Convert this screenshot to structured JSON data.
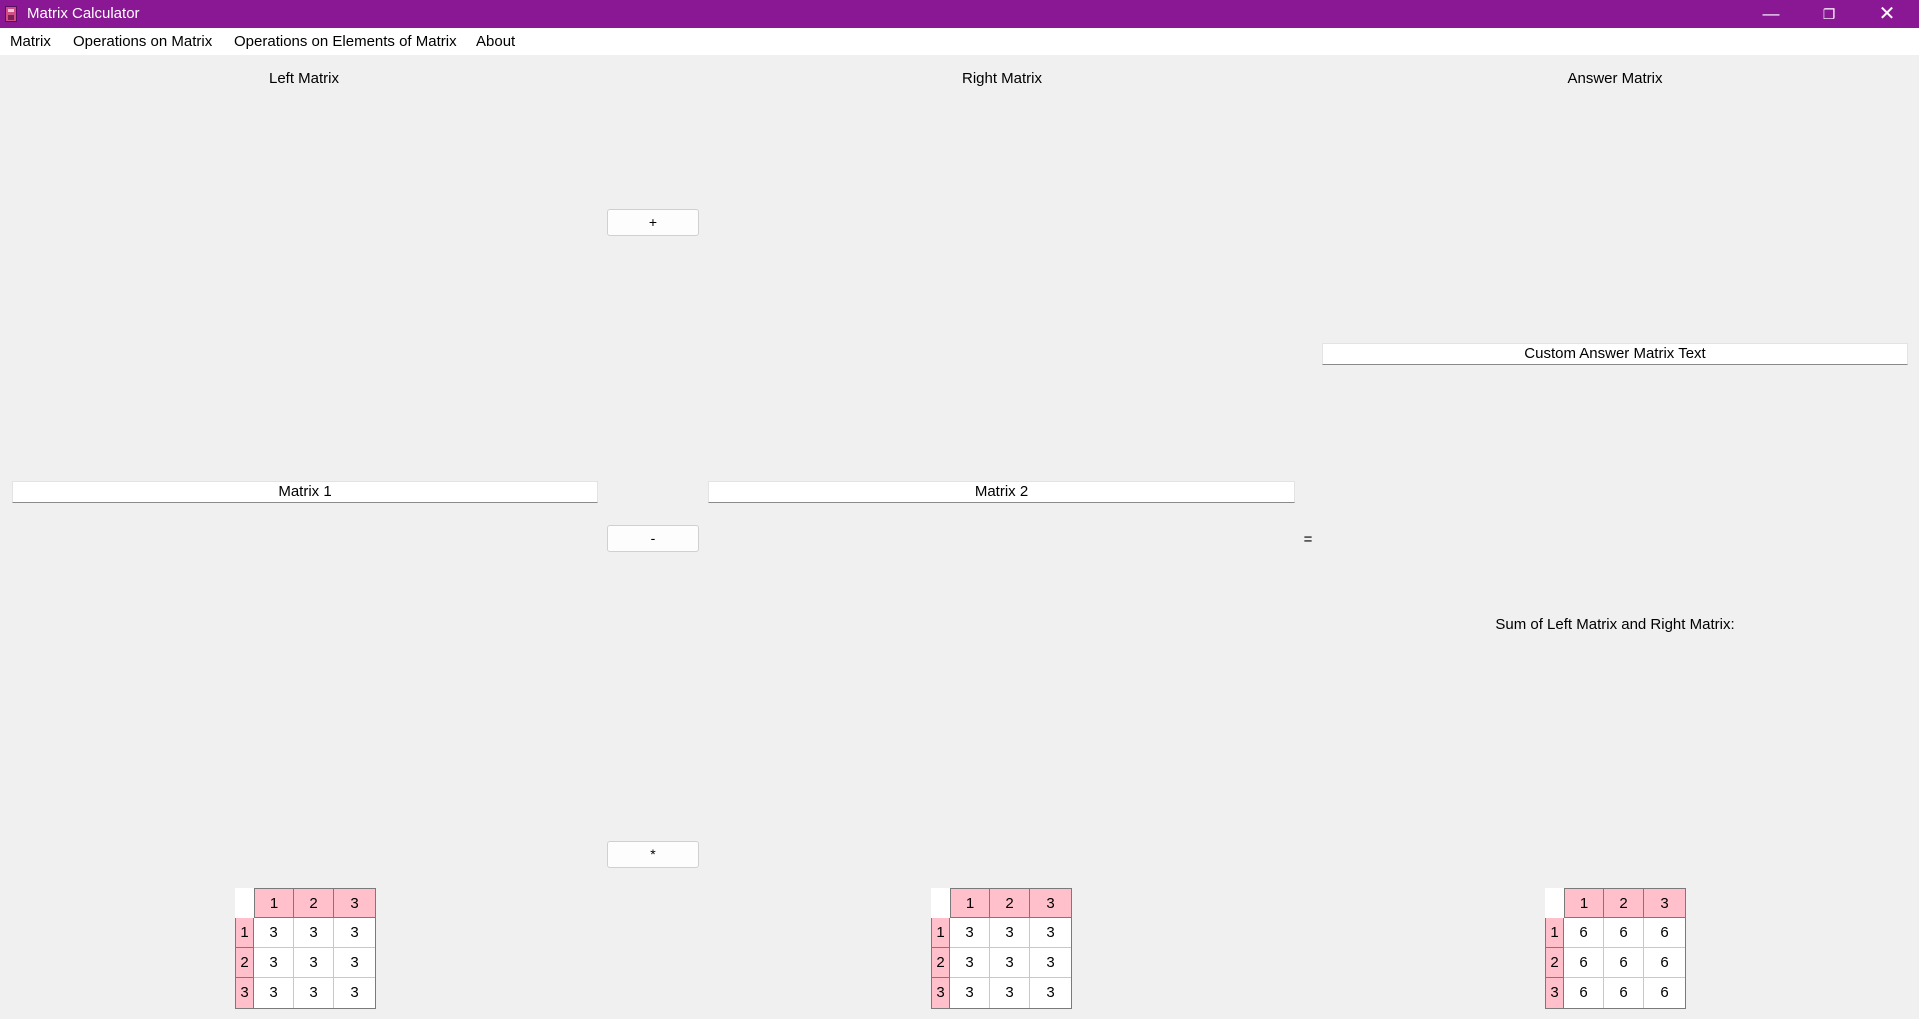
{
  "window": {
    "title": "Matrix Calculator",
    "controls": {
      "minimize": "—",
      "maximize": "❐",
      "close": "✕"
    }
  },
  "menu": [
    "Matrix",
    "Operations on Matrix",
    "Operations on Elements of Matrix",
    "About"
  ],
  "left": {
    "heading": "Left Matrix",
    "name": "Matrix 1"
  },
  "right": {
    "heading": "Right Matrix",
    "name": "Matrix 2"
  },
  "answer": {
    "heading": "Answer Matrix",
    "custom_text": "Custom Answer Matrix Text",
    "description": "Sum of Left Matrix and Right Matrix:",
    "equals": "="
  },
  "operators": {
    "plus": "+",
    "minus": "-",
    "multiply": "*"
  },
  "grids": {
    "left": {
      "cols": [
        "1",
        "2",
        "3"
      ],
      "rows": [
        "1",
        "2",
        "3"
      ],
      "cells": [
        [
          "3",
          "3",
          "3"
        ],
        [
          "3",
          "3",
          "3"
        ],
        [
          "3",
          "3",
          "3"
        ]
      ]
    },
    "right": {
      "cols": [
        "1",
        "2",
        "3"
      ],
      "rows": [
        "1",
        "2",
        "3"
      ],
      "cells": [
        [
          "3",
          "3",
          "3"
        ],
        [
          "3",
          "3",
          "3"
        ],
        [
          "3",
          "3",
          "3"
        ]
      ]
    },
    "answer": {
      "cols": [
        "1",
        "2",
        "3"
      ],
      "rows": [
        "1",
        "2",
        "3"
      ],
      "cells": [
        [
          "6",
          "6",
          "6"
        ],
        [
          "6",
          "6",
          "6"
        ],
        [
          "6",
          "6",
          "6"
        ]
      ]
    }
  },
  "colors": {
    "title_bar": "#8a1894",
    "header_cell": "#ffc0cb",
    "background": "#f0f0f0"
  }
}
